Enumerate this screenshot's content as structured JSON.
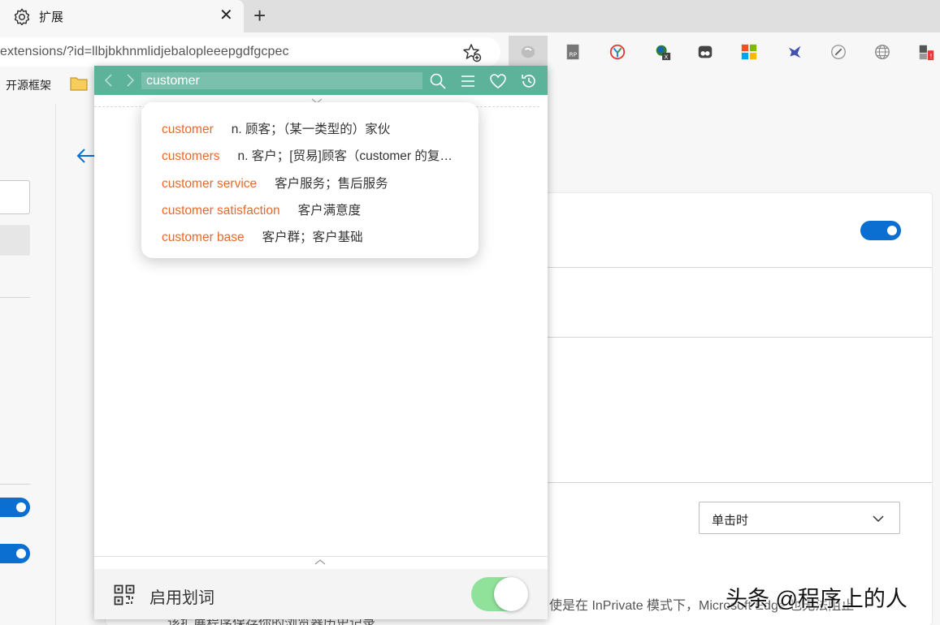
{
  "tab": {
    "title": "扩展"
  },
  "address_bar": {
    "url": "extensions/?id=llbjbkhnmlidjebalopleeepgdfgcpec"
  },
  "bookmarks": {
    "item1": "开源框架"
  },
  "popup": {
    "search_value": "customer",
    "suggestions": [
      {
        "word": "customer",
        "definition": "n. 顾客；（某一类型的）家伙"
      },
      {
        "word": "customers",
        "definition": "n. 客户；[贸易]顾客（customer 的复数）"
      },
      {
        "word": "customer service",
        "definition": "客户服务；售后服务"
      },
      {
        "word": "customer satisfaction",
        "definition": "客户满意度"
      },
      {
        "word": "customer base",
        "definition": "客户群；客户基础"
      }
    ],
    "footer_label": "启用划词",
    "enable_toggle_on": true
  },
  "page": {
    "select_value": "单击时",
    "note_line1": "使是在 InPrivate 模式下，Microsoft Edge 也无法阻止",
    "note_line2": "该扩展程序保存你的浏览器历史记录"
  },
  "watermark": "头条 @程序上的人",
  "colors": {
    "popup_header": "#5db39a",
    "suggest_word": "#e8692a",
    "toggle_green": "#90e19a",
    "edge_blue": "#0a6fd0"
  }
}
